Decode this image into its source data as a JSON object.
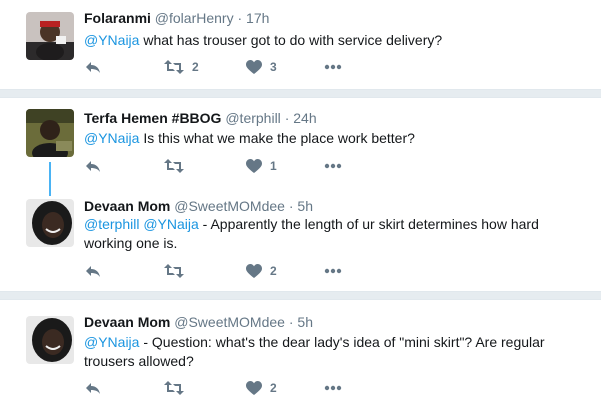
{
  "tweets": [
    {
      "name": "Folaranmi",
      "handle": "@folarHenry",
      "dot": "·",
      "time": "17h",
      "mention": "@YNaija",
      "body": " what has trouser got to do with service delivery?",
      "retweets": "2",
      "likes": "3"
    },
    {
      "name": "Terfa Hemen #BBOG",
      "handle": "@terphill",
      "dot": "·",
      "time": "24h",
      "mention": "@YNaija",
      "body": " Is this what we make the place work better?",
      "retweets": "",
      "likes": "1"
    },
    {
      "name": "Devaan Mom",
      "handle": "@SweetMOMdee",
      "dot": "·",
      "time": "5h",
      "mention": "@terphill",
      "mention2": "@YNaija",
      "body": " - Apparently the length of ur skirt determines how hard working one is.",
      "retweets": "",
      "likes": "2"
    },
    {
      "name": "Devaan Mom",
      "handle": "@SweetMOMdee",
      "dot": "·",
      "time": "5h",
      "mention": "@YNaija",
      "body": " - Question: what's the dear lady's idea of \"mini skirt\"? Are regular trousers allowed?",
      "retweets": "",
      "likes": "2"
    }
  ],
  "icons": {
    "reply": "reply-icon",
    "retweet": "retweet-icon",
    "like": "heart-icon",
    "more": "more-dots-icon"
  },
  "colors": {
    "link": "#1b95e0",
    "muted": "#657786",
    "thread": "#4ab3f4",
    "separator": "#e6ecf0"
  }
}
